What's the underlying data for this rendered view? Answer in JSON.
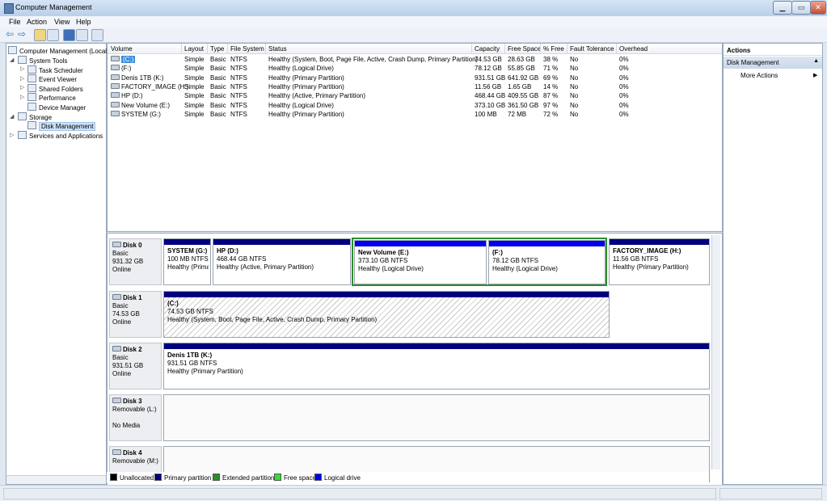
{
  "window": {
    "title": "Computer Management",
    "minimize": "▁",
    "maximize": "▭",
    "close": "✕"
  },
  "menu": {
    "file": "File",
    "action": "Action",
    "view": "View",
    "help": "Help"
  },
  "tree": {
    "root": "Computer Management (Local",
    "system_tools": "System Tools",
    "task_scheduler": "Task Scheduler",
    "event_viewer": "Event Viewer",
    "shared_folders": "Shared Folders",
    "performance": "Performance",
    "device_manager": "Device Manager",
    "storage": "Storage",
    "disk_management": "Disk Management",
    "services": "Services and Applications"
  },
  "volumes": {
    "headers": [
      "Volume",
      "Layout",
      "Type",
      "File System",
      "Status",
      "Capacity",
      "Free Space",
      "% Free",
      "Fault Tolerance",
      "Overhead"
    ],
    "rows": [
      [
        "(C:)",
        "Simple",
        "Basic",
        "NTFS",
        "Healthy (System, Boot, Page File, Active, Crash Dump, Primary Partition)",
        "74.53 GB",
        "28.63 GB",
        "38 %",
        "No",
        "0%"
      ],
      [
        "(F:)",
        "Simple",
        "Basic",
        "NTFS",
        "Healthy (Logical Drive)",
        "78.12 GB",
        "55.85 GB",
        "71 %",
        "No",
        "0%"
      ],
      [
        "Denis 1TB (K:)",
        "Simple",
        "Basic",
        "NTFS",
        "Healthy (Primary Partition)",
        "931.51 GB",
        "641.92 GB",
        "69 %",
        "No",
        "0%"
      ],
      [
        "FACTORY_IMAGE (H:)",
        "Simple",
        "Basic",
        "NTFS",
        "Healthy (Primary Partition)",
        "11.56 GB",
        "1.65 GB",
        "14 %",
        "No",
        "0%"
      ],
      [
        "HP (D:)",
        "Simple",
        "Basic",
        "NTFS",
        "Healthy (Active, Primary Partition)",
        "468.44 GB",
        "409.55 GB",
        "87 %",
        "No",
        "0%"
      ],
      [
        "New Volume (E:)",
        "Simple",
        "Basic",
        "NTFS",
        "Healthy (Logical Drive)",
        "373.10 GB",
        "361.50 GB",
        "97 %",
        "No",
        "0%"
      ],
      [
        "SYSTEM (G:)",
        "Simple",
        "Basic",
        "NTFS",
        "Healthy (Primary Partition)",
        "100 MB",
        "72 MB",
        "72 %",
        "No",
        "0%"
      ]
    ]
  },
  "disks": {
    "disk0": {
      "name": "Disk 0",
      "type": "Basic",
      "size": "931.32 GB",
      "state": "Online"
    },
    "disk1": {
      "name": "Disk 1",
      "type": "Basic",
      "size": "74.53 GB",
      "state": "Online"
    },
    "disk2": {
      "name": "Disk 2",
      "type": "Basic",
      "size": "931.51 GB",
      "state": "Online"
    },
    "disk3": {
      "name": "Disk 3",
      "type": "Removable (L:)",
      "size": "",
      "state": "No Media"
    },
    "disk4": {
      "name": "Disk 4",
      "type": "Removable (M:)"
    }
  },
  "partitions": {
    "system_g": {
      "name": "SYSTEM  (G:)",
      "size": "100 MB NTFS",
      "status": "Healthy (Prima"
    },
    "hp_d": {
      "name": "HP  (D:)",
      "size": "468.44 GB NTFS",
      "status": "Healthy (Active, Primary Partition)"
    },
    "newvol_e": {
      "name": "New Volume  (E:)",
      "size": "373.10 GB NTFS",
      "status": "Healthy (Logical Drive)"
    },
    "f": {
      "name": "(F:)",
      "size": "78.12 GB NTFS",
      "status": "Healthy (Logical Drive)"
    },
    "factory_h": {
      "name": "FACTORY_IMAGE  (H:)",
      "size": "11.56 GB NTFS",
      "status": "Healthy (Primary Partition)"
    },
    "c": {
      "name": "(C:)",
      "size": "74.53 GB NTFS",
      "status": "Healthy (System, Boot, Page File, Active, Crash Dump, Primary Partition)"
    },
    "k": {
      "name": "Denis 1TB  (K:)",
      "size": "931.51 GB NTFS",
      "status": "Healthy (Primary Partition)"
    }
  },
  "legend": {
    "unallocated": "Unallocated",
    "primary": "Primary partition",
    "extended": "Extended partition",
    "free": "Free space",
    "logical": "Logical drive"
  },
  "colors": {
    "unallocated": "#000000",
    "primary": "#00007f",
    "extended": "#2e8b2e",
    "free": "#33dd33",
    "logical": "#0000ee"
  },
  "actions": {
    "title": "Actions",
    "section": "Disk Management",
    "more": "More Actions"
  }
}
